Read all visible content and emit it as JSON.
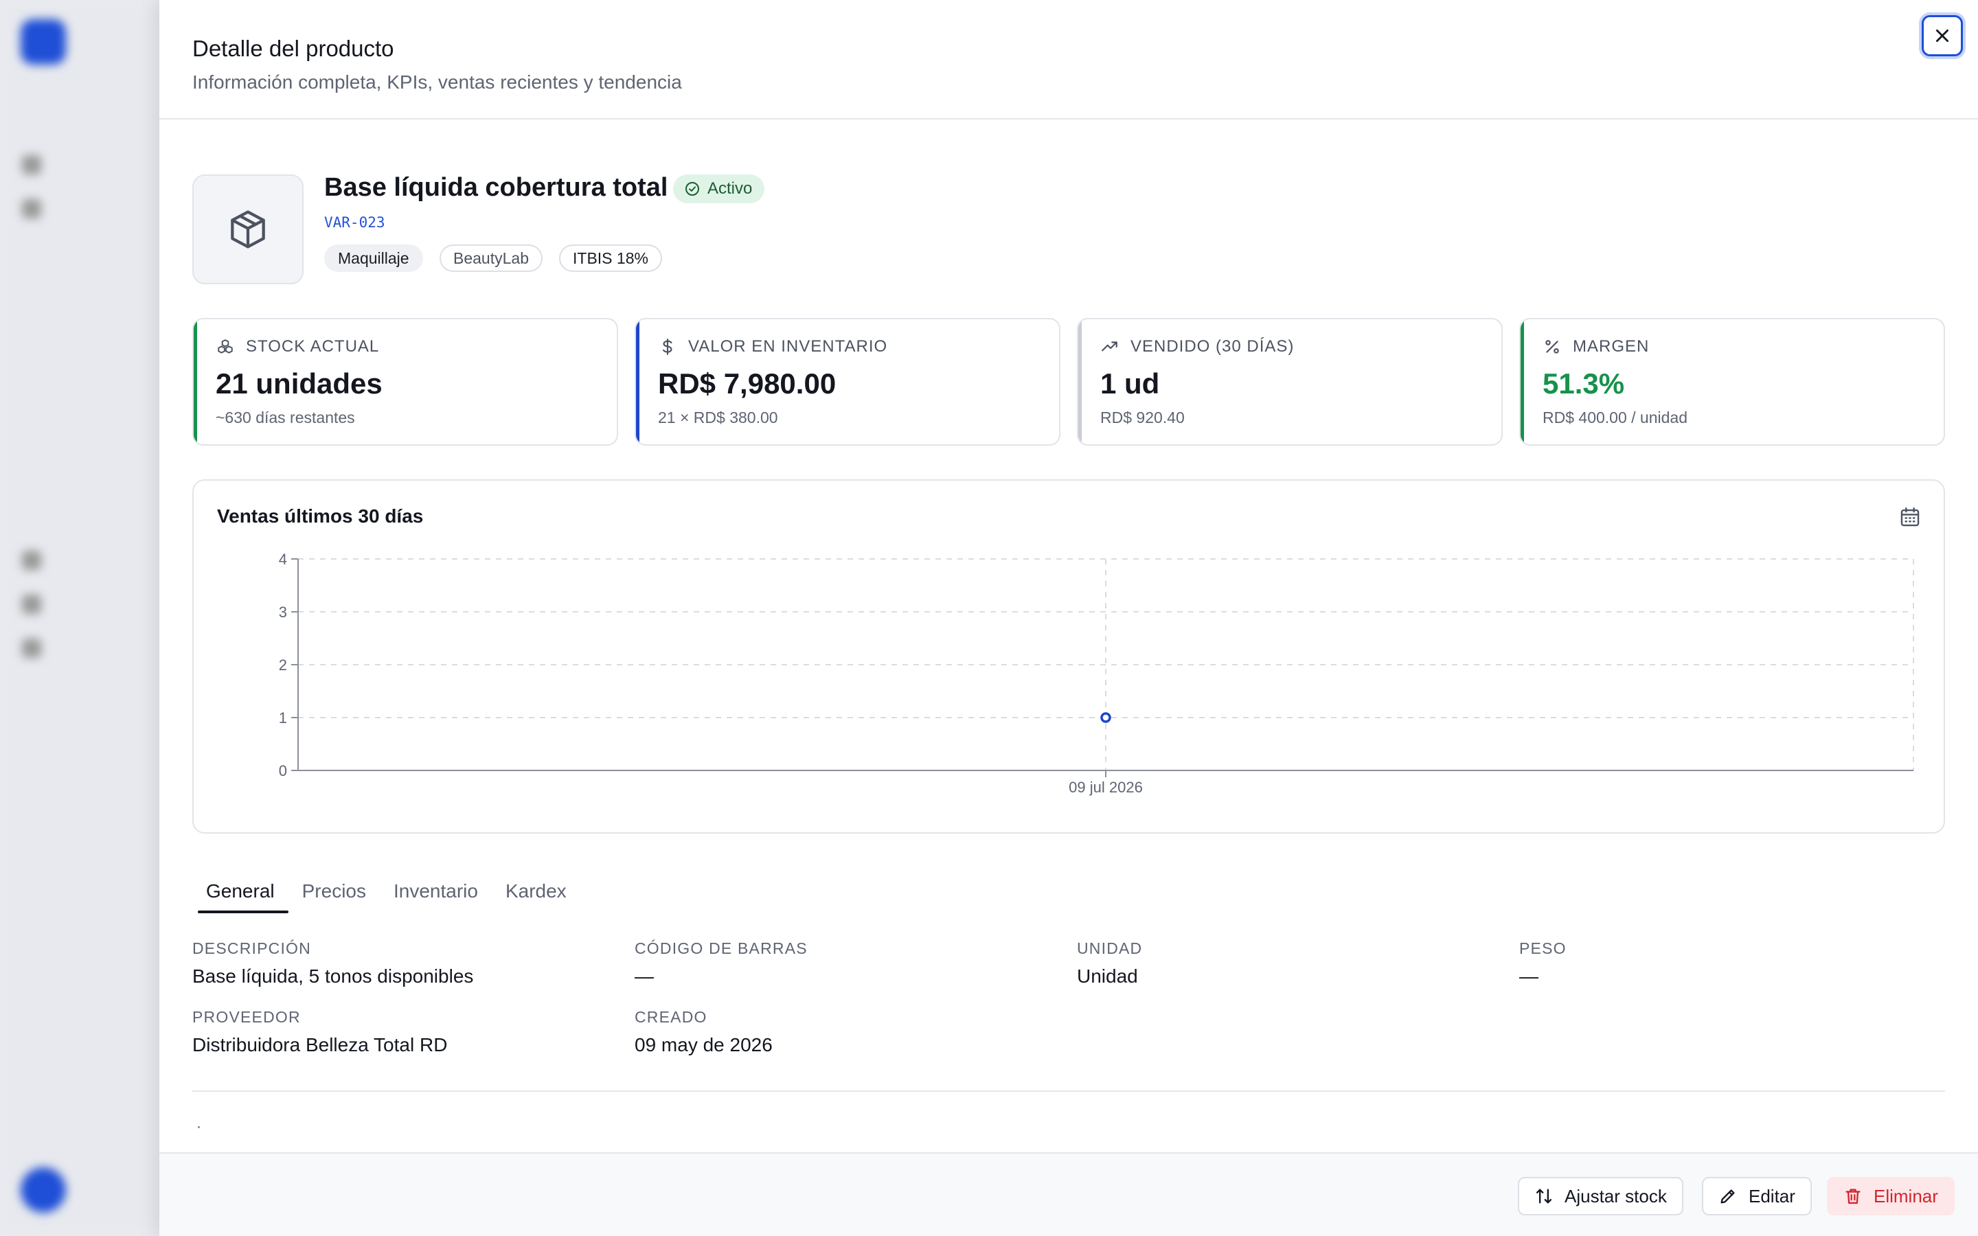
{
  "panel": {
    "title": "Detalle del producto",
    "subtitle": "Información completa, KPIs, ventas recientes y tendencia",
    "close_icon": "x-icon"
  },
  "product": {
    "icon": "package-icon",
    "name": "Base líquida cobertura total",
    "status": "Activo",
    "sku": "VAR-023",
    "tags": [
      "Maquillaje",
      "BeautyLab",
      "ITBIS 18%"
    ]
  },
  "kpis": [
    {
      "icon": "boxes-icon",
      "label": "STOCK ACTUAL",
      "value": "21 unidades",
      "sub": "~630 días restantes",
      "accent": "#16924b",
      "value_color": "#14171f"
    },
    {
      "icon": "dollar-icon",
      "label": "VALOR EN INVENTARIO",
      "value": "RD$ 7,980.00",
      "sub": "21 × RD$ 380.00",
      "accent": "#1f45c9",
      "value_color": "#14171f"
    },
    {
      "icon": "trending-up-icon",
      "label": "VENDIDO (30 DÍAS)",
      "value": "1 ud",
      "sub": "RD$ 920.40",
      "accent": "#c9ccd3",
      "value_color": "#14171f"
    },
    {
      "icon": "percent-icon",
      "label": "MARGEN",
      "value": "51.3%",
      "sub": "RD$ 400.00 / unidad",
      "accent": "#16924b",
      "value_color": "#16924b"
    }
  ],
  "chart": {
    "title": "Ventas últimos 30 días",
    "calendar_icon": "calendar-icon"
  },
  "chart_data": {
    "type": "line",
    "title": "Ventas últimos 30 días",
    "x": [
      "09 jul 2026"
    ],
    "series": [
      {
        "values": [
          1
        ],
        "color": "#1f45c9"
      }
    ],
    "yticks": [
      "0",
      "1",
      "2",
      "3",
      "4"
    ],
    "ylim": [
      0,
      4
    ],
    "grid": true
  },
  "tabs": [
    "General",
    "Precios",
    "Inventario",
    "Kardex"
  ],
  "details": {
    "descripcion_label": "DESCRIPCIÓN",
    "descripcion": "Base líquida, 5 tonos disponibles",
    "barcode_label": "CÓDIGO DE BARRAS",
    "barcode": "—",
    "unidad_label": "UNIDAD",
    "unidad": "Unidad",
    "peso_label": "PESO",
    "peso": "—",
    "proveedor_label": "PROVEEDOR",
    "proveedor": "Distribuidora Belleza Total RD",
    "creado_label": "CREADO",
    "creado": "09 may de 2026"
  },
  "footer": {
    "adjust_label": "Ajustar stock",
    "adjust_icon": "arrows-up-down-icon",
    "edit_label": "Editar",
    "edit_icon": "pencil-icon",
    "delete_label": "Eliminar",
    "delete_icon": "trash-icon"
  }
}
